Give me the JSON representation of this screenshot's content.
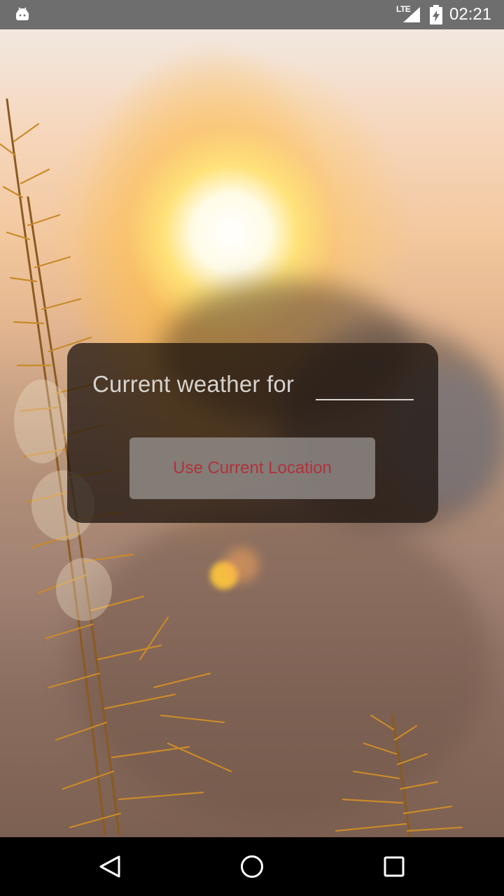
{
  "status_bar": {
    "network_label": "LTE",
    "time": "02:21",
    "icons": [
      "android-icon",
      "signal-icon",
      "battery-icon"
    ]
  },
  "card": {
    "prompt": "Current weather for",
    "city_input_value": "",
    "city_input_placeholder": "",
    "button_label": "Use Current Location"
  },
  "nav_bar": {
    "icons": [
      "back-icon",
      "home-icon",
      "recents-icon"
    ]
  },
  "colors": {
    "card_background": "#160e0a",
    "button_text": "#b0323c",
    "status_bar": "#6e6e6e",
    "nav_bar": "#000000"
  }
}
